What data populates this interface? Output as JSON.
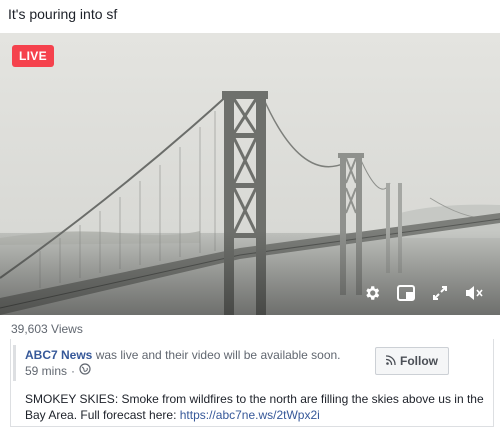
{
  "post": {
    "text": "It's pouring into sf"
  },
  "video": {
    "live_badge": "LIVE",
    "controls": {
      "settings_icon": "gear-icon",
      "pip_icon": "picture-in-picture-icon",
      "fullscreen_icon": "expand-icon",
      "mute_icon": "speaker-muted-icon"
    }
  },
  "stats": {
    "views": "39,603 Views"
  },
  "card": {
    "page_name": "ABC7 News",
    "status": " was live and their video will be available soon.",
    "time": "59 mins",
    "separator": "·",
    "privacy_icon": "globe-icon",
    "follow_label": "Follow",
    "follow_icon": "rss-icon",
    "description": "SMOKEY SKIES: Smoke from wildfires to the north are filling the skies above us in the Bay Area. Full forecast here: ",
    "link": "https://abc7ne.ws/2tWpx2i"
  },
  "colors": {
    "live": "#f5424d",
    "link": "#365899"
  }
}
